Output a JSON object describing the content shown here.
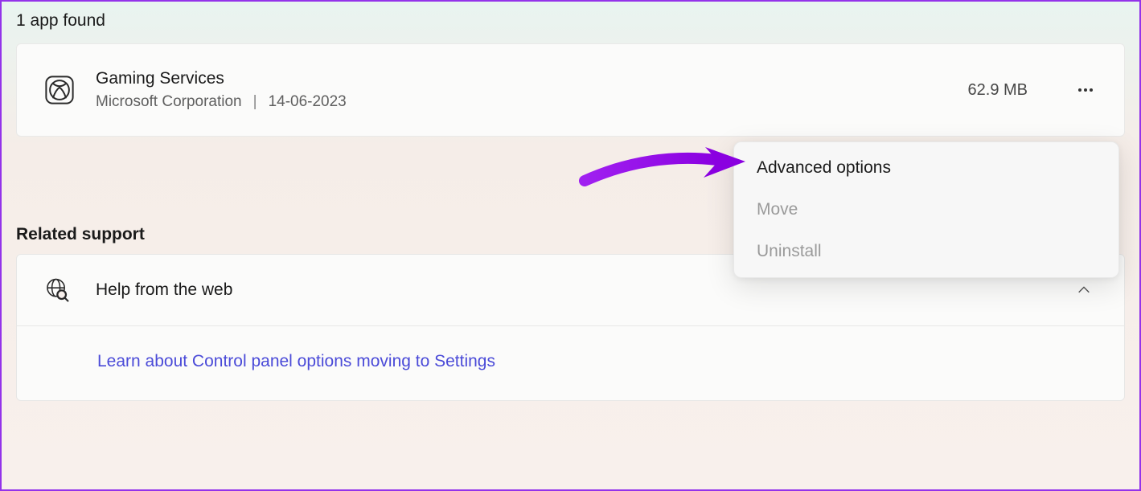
{
  "header": {
    "results_text": "1 app found"
  },
  "app": {
    "name": "Gaming Services",
    "publisher": "Microsoft Corporation",
    "install_date": "14-06-2023",
    "size": "62.9 MB"
  },
  "menu": {
    "advanced": "Advanced options",
    "move": "Move",
    "uninstall": "Uninstall"
  },
  "support": {
    "section_title": "Related support",
    "help_title": "Help from the web",
    "link_text": "Learn about Control panel options moving to Settings"
  }
}
